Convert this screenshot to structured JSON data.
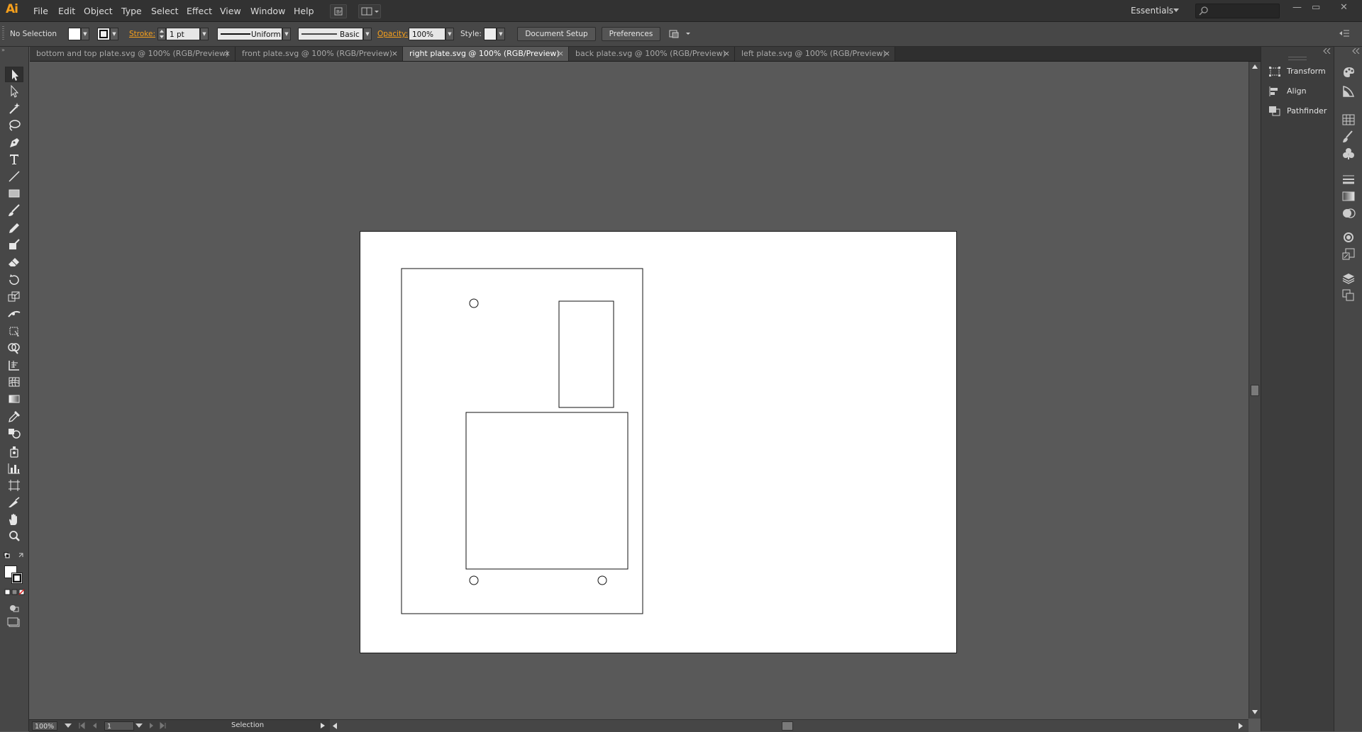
{
  "app": {
    "logo": "Ai",
    "menu": [
      "File",
      "Edit",
      "Object",
      "Type",
      "Select",
      "Effect",
      "View",
      "Window",
      "Help"
    ],
    "workspace": "Essentials",
    "window_controls": {
      "minimize": "—",
      "restore": "▭",
      "close": "✕"
    }
  },
  "control_bar": {
    "selection": "No Selection",
    "stroke_label": "Stroke:",
    "stroke_weight": "1 pt",
    "profile": "Uniform",
    "brush": "Basic",
    "opacity_label": "Opacity:",
    "opacity_value": "100%",
    "style_label": "Style:",
    "document_setup": "Document Setup",
    "preferences": "Preferences"
  },
  "tabs": [
    {
      "title": "bottom and top plate.svg @ 100% (RGB/Preview)",
      "active": false
    },
    {
      "title": "front plate.svg @ 100% (RGB/Preview)",
      "active": false
    },
    {
      "title": "right plate.svg @ 100% (RGB/Preview)",
      "active": true
    },
    {
      "title": "back plate.svg @ 100% (RGB/Preview)",
      "active": false
    },
    {
      "title": "left plate.svg @ 100% (RGB/Preview)",
      "active": false
    }
  ],
  "tab_close": "×",
  "status": {
    "zoom": "100%",
    "artboard_number": "1",
    "current_tool": "Selection"
  },
  "panels": {
    "transform": "Transform",
    "align": "Align",
    "pathfinder": "Pathfinder"
  },
  "colors": {
    "accent": "#f7a01c",
    "canvas": "#595959",
    "artboard": "#ffffff"
  }
}
